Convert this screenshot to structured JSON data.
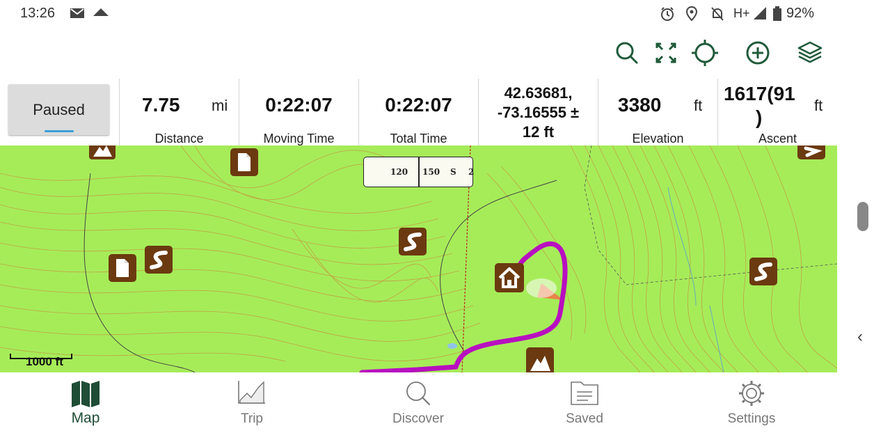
{
  "status_bar": {
    "time": "13:26",
    "network": "H+",
    "battery": "92%"
  },
  "toolbar": {
    "icons": [
      "search-icon",
      "fullscreen-icon",
      "locate-icon",
      "add-icon",
      "layers-icon"
    ],
    "accent_color": "#1f5a3a"
  },
  "stats": {
    "paused_label": "Paused",
    "distance": {
      "value": "7.75",
      "unit": "mi",
      "label": "Distance"
    },
    "moving_time": {
      "value": "0:22:07",
      "label": "Moving Time"
    },
    "total_time": {
      "value": "0:22:07",
      "label": "Total Time"
    },
    "coordinates": {
      "line1": "42.63681,",
      "line2": "-73.16555 ±",
      "line3": "12 ft"
    },
    "elevation": {
      "value": "3380",
      "unit": "ft",
      "label": "Elevation"
    },
    "ascent": {
      "line1": "1617(91",
      "line2": ")",
      "unit": "ft",
      "label": "Ascent"
    }
  },
  "map": {
    "scale_label": "1000 ft",
    "compass": {
      "tick_a": "120",
      "tick_b": "150",
      "tick_c": "S",
      "tick_d": "2"
    },
    "land_color": "#a6ec59",
    "track_color": "#b80fc0",
    "marker_color": "#6b3a10"
  },
  "bottom_nav": {
    "items": [
      {
        "label": "Map",
        "icon": "map-icon",
        "active": true
      },
      {
        "label": "Trip",
        "icon": "trip-chart-icon",
        "active": false
      },
      {
        "label": "Discover",
        "icon": "discover-search-icon",
        "active": false
      },
      {
        "label": "Saved",
        "icon": "saved-folder-icon",
        "active": false
      },
      {
        "label": "Settings",
        "icon": "settings-gear-icon",
        "active": false
      }
    ]
  }
}
